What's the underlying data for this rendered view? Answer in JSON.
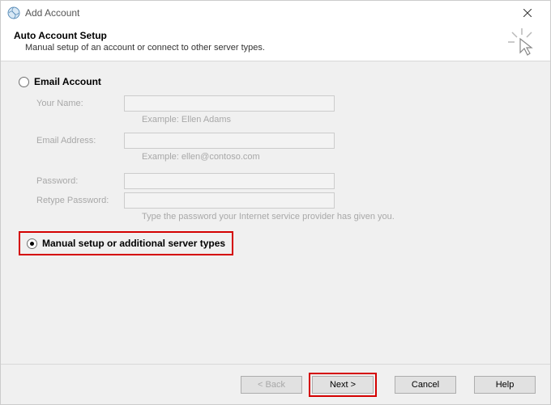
{
  "titlebar": {
    "title": "Add Account"
  },
  "header": {
    "title": "Auto Account Setup",
    "subtitle": "Manual setup of an account or connect to other server types."
  },
  "options": {
    "email_account": {
      "label": "Email Account",
      "selected": false
    },
    "manual_setup": {
      "label": "Manual setup or additional server types",
      "selected": true
    }
  },
  "form": {
    "name_label": "Your Name:",
    "name_value": "",
    "name_hint": "Example: Ellen Adams",
    "email_label": "Email Address:",
    "email_value": "",
    "email_hint": "Example: ellen@contoso.com",
    "password_label": "Password:",
    "password_value": "",
    "retype_label": "Retype Password:",
    "retype_value": "",
    "password_hint": "Type the password your Internet service provider has given you."
  },
  "buttons": {
    "back": "< Back",
    "next": "Next >",
    "cancel": "Cancel",
    "help": "Help"
  }
}
